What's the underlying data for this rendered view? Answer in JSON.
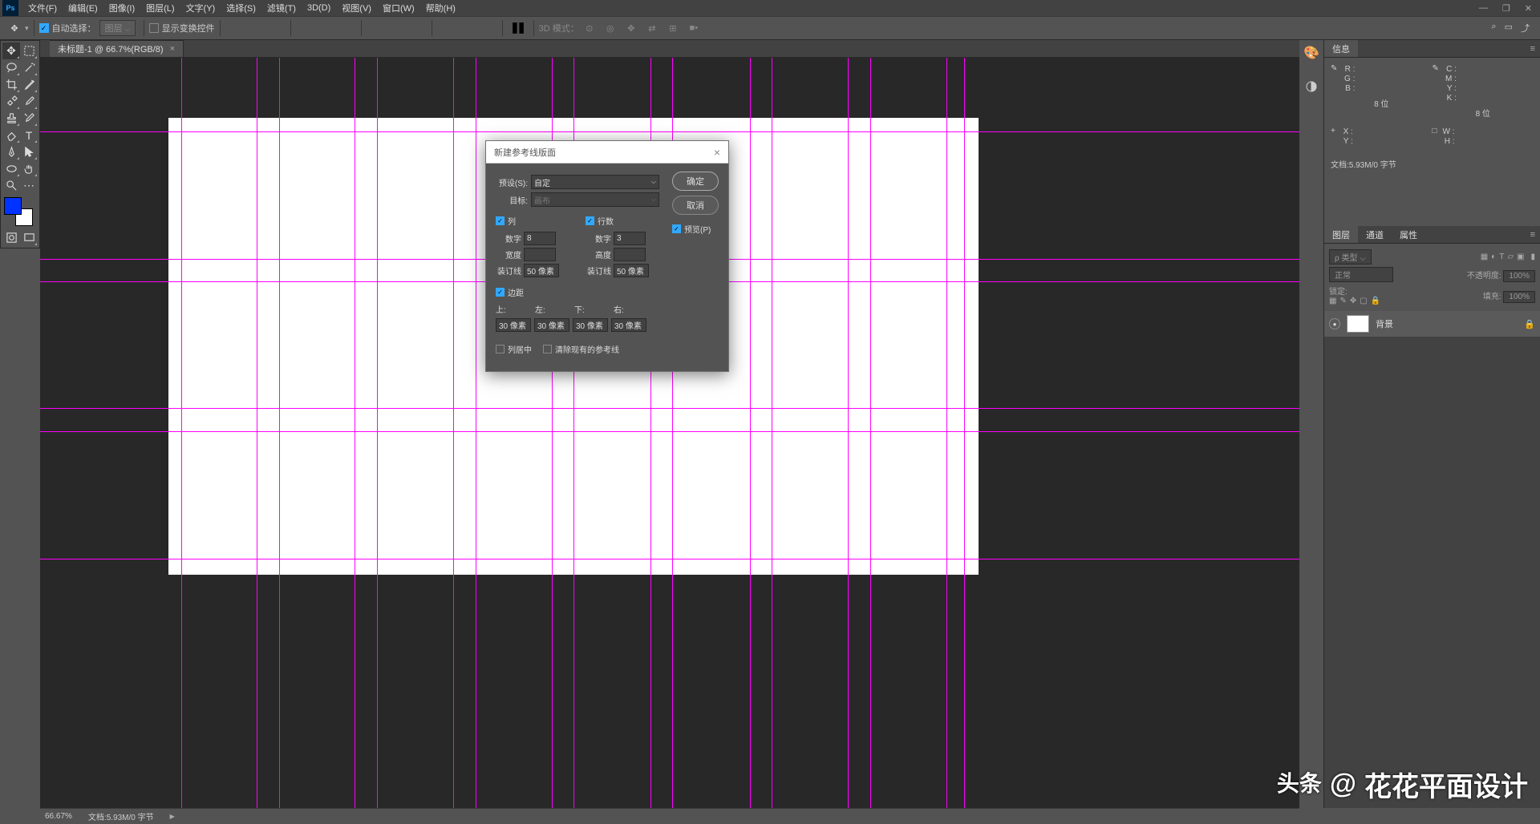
{
  "menu": [
    "文件(F)",
    "编辑(E)",
    "图像(I)",
    "图层(L)",
    "文字(Y)",
    "选择(S)",
    "滤镜(T)",
    "3D(D)",
    "视图(V)",
    "窗口(W)",
    "帮助(H)"
  ],
  "options": {
    "auto_select": "自动选择：",
    "layer_dd": "图层",
    "show_transform": "显示变换控件",
    "mode_3d": "3D 模式："
  },
  "tab": {
    "title": "未标题-1 @ 66.7%(RGB/8)"
  },
  "dialog": {
    "title": "新建参考线版面",
    "preset_lbl": "预设(S):",
    "preset_val": "自定",
    "target_lbl": "目标:",
    "target_val": "画布",
    "ok": "确定",
    "cancel": "取消",
    "preview": "预览(P)",
    "col_chk": "列",
    "row_chk": "行数",
    "count_lbl": "数字",
    "col_count": "8",
    "row_count": "3",
    "width_lbl": "宽度",
    "height_lbl": "高度",
    "gutter_lbl": "装订线",
    "col_gutter": "50 像素",
    "row_gutter": "50 像素",
    "margin_chk": "边距",
    "top_lbl": "上:",
    "left_lbl": "左:",
    "bottom_lbl": "下:",
    "right_lbl": "右:",
    "m_top": "30 像素",
    "m_left": "30 像素",
    "m_bottom": "30 像素",
    "m_right": "30 像素",
    "center_cols": "列居中",
    "clear_guides": "清除现有的参考线"
  },
  "info": {
    "tab": "信息",
    "r": "R :",
    "g": "G :",
    "b": "B :",
    "c": "C :",
    "m": "M :",
    "y": "Y :",
    "k": "K :",
    "bits1": "8 位",
    "bits2": "8 位",
    "x": "X :",
    "yp": "Y :",
    "w": "W :",
    "h": "H :",
    "doc": "文档:5.93M/0 字节"
  },
  "layers": {
    "tabs": [
      "图层",
      "通道",
      "属性"
    ],
    "kind_lbl": "ρ 类型",
    "normal": "正常",
    "opacity_lbl": "不透明度:",
    "opacity_val": "100%",
    "lock_lbl": "锁定:",
    "fill_lbl": "填充:",
    "fill_val": "100%",
    "bg_layer": "背景"
  },
  "status": {
    "zoom": "66.67%",
    "doc": "文档:5.93M/0 字节"
  },
  "watermark": {
    "brand1": "头条",
    "at": "@",
    "name": "花花平面设计"
  }
}
